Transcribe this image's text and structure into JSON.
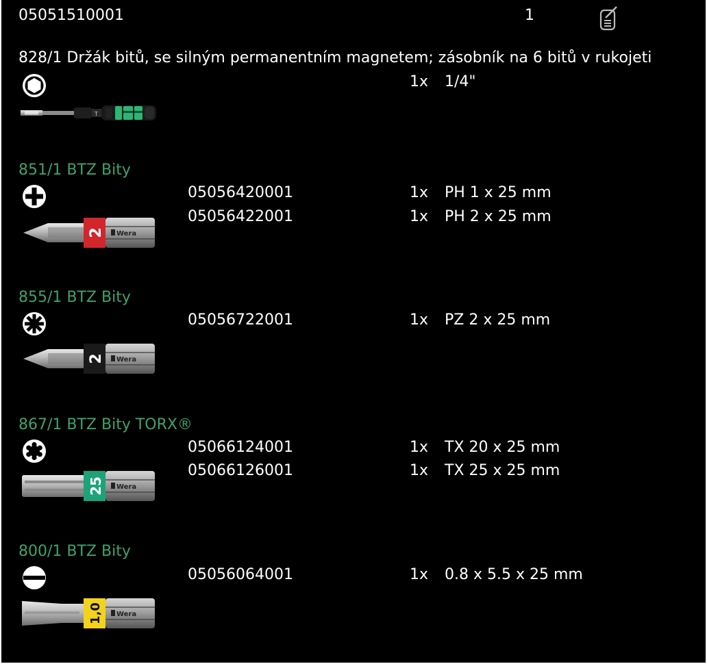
{
  "header": {
    "article_no": "05051510001",
    "quantity": "1",
    "icon": "document-edit-icon"
  },
  "holder": {
    "title": "828/1 Držák bitů, se silným permanentním magnetem; zásobník na 6 bitů v rukojeti",
    "drive_icon": "hex-drive-icon",
    "qty": "1x",
    "size": "1/4\""
  },
  "groups": [
    {
      "title": "851/1 BTZ Bity",
      "icon": "phillips-icon",
      "bit_label": "2",
      "band_color": "#d0262c",
      "items": [
        {
          "code": "05056420001",
          "qty": "1x",
          "size": "PH 1 x 25 mm"
        },
        {
          "code": "05056422001",
          "qty": "1x",
          "size": "PH 2 x 25 mm"
        }
      ]
    },
    {
      "title": "855/1 BTZ Bity",
      "icon": "pozidriv-icon",
      "bit_label": "2",
      "band_color": "#1a1a1a",
      "items": [
        {
          "code": "05056722001",
          "qty": "1x",
          "size": "PZ 2 x 25 mm"
        }
      ]
    },
    {
      "title": "867/1 BTZ Bity TORX®",
      "icon": "torx-icon",
      "bit_label": "25",
      "band_color": "#1ca37a",
      "items": [
        {
          "code": "05066124001",
          "qty": "1x",
          "size": "TX 20 x 25 mm"
        },
        {
          "code": "05066126001",
          "qty": "1x",
          "size": "TX 25 x 25 mm"
        }
      ]
    },
    {
      "title": "800/1 BTZ Bity",
      "icon": "slotted-icon",
      "bit_label": "1,0",
      "band_color": "#f3d21b",
      "items": [
        {
          "code": "05056064001",
          "qty": "1x",
          "size": "0.8 x 5.5 x 25 mm"
        }
      ]
    }
  ],
  "bit_brand": "Wera",
  "colors": {
    "background": "#000000",
    "text": "#ffffff",
    "group_title": "#3fa36b",
    "handle_green": "#2bb673"
  }
}
